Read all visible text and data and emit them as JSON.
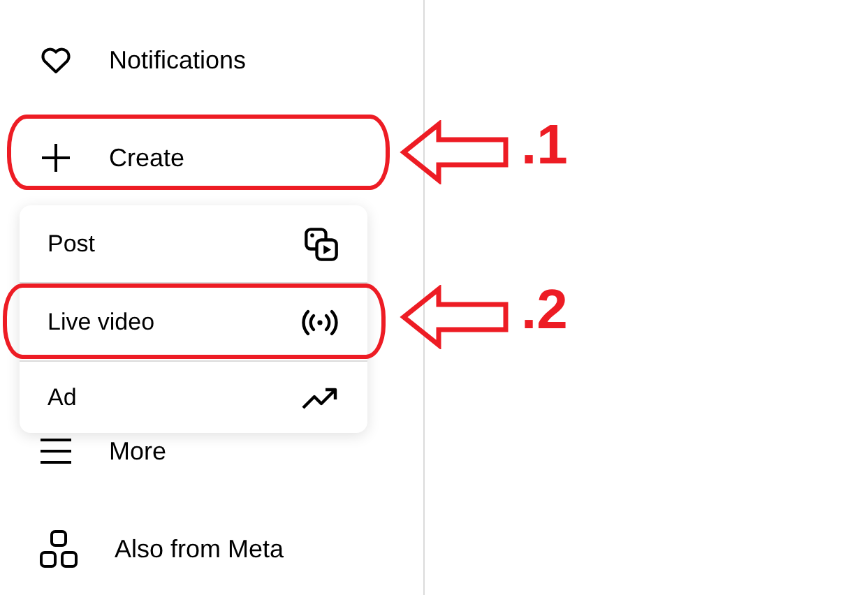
{
  "nav_items": [
    {
      "label": "Notifications"
    },
    {
      "label": "Create"
    }
  ],
  "create_menu": [
    {
      "label": "Post"
    },
    {
      "label": "Live video"
    },
    {
      "label": "Ad"
    }
  ],
  "nav_items_below": [
    {
      "label": "More"
    },
    {
      "label": "Also from Meta"
    }
  ],
  "annotations": [
    {
      "label": ".1"
    },
    {
      "label": ".2"
    }
  ]
}
